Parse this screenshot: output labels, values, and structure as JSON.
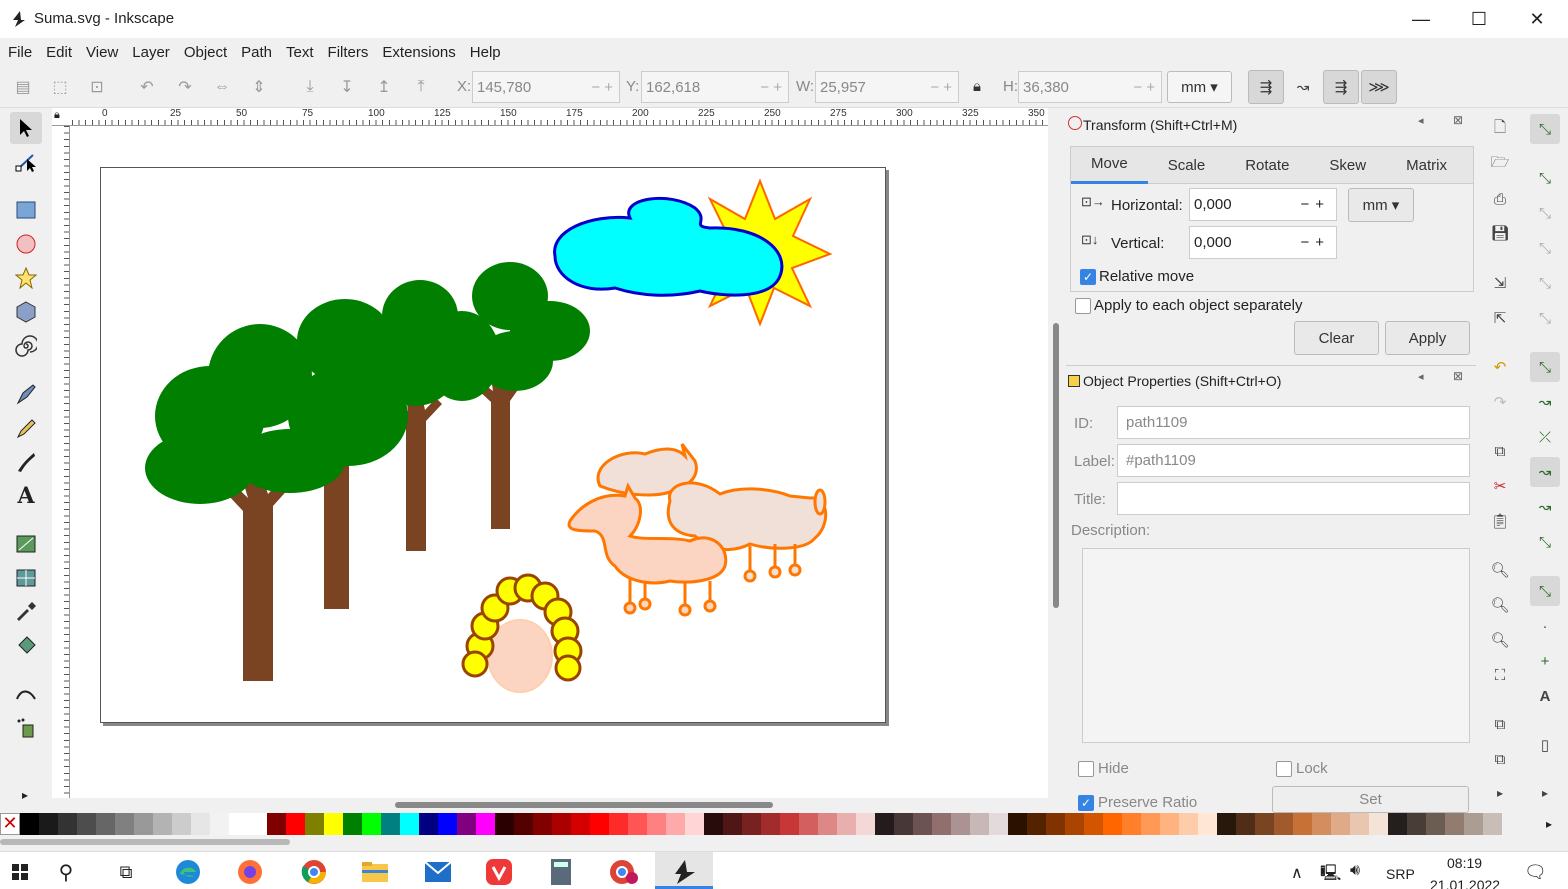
{
  "window": {
    "title": "Suma.svg - Inkscape",
    "minimize": "—",
    "maximize": "☐",
    "close": "✕"
  },
  "menu": [
    "File",
    "Edit",
    "View",
    "Layer",
    "Object",
    "Path",
    "Text",
    "Filters",
    "Extensions",
    "Help"
  ],
  "coords": {
    "x_label": "X:",
    "x": "145,780",
    "y_label": "Y:",
    "y": "162,618",
    "w_label": "W:",
    "w": "25,957",
    "h_label": "H:",
    "h": "36,380",
    "unit": "mm"
  },
  "ruler_h": [
    "0",
    "25",
    "50",
    "75",
    "100",
    "125",
    "150",
    "175",
    "200",
    "225",
    "250",
    "275",
    "300",
    "325",
    "350"
  ],
  "transform": {
    "title": "Transform (Shift+Ctrl+M)",
    "tabs": [
      "Move",
      "Scale",
      "Rotate",
      "Skew",
      "Matrix"
    ],
    "active_tab": "Move",
    "horizontal_label": "Horizontal:",
    "horizontal": "0,000",
    "vertical_label": "Vertical:",
    "vertical": "0,000",
    "unit": "mm",
    "relative_move": "Relative move",
    "relative_move_checked": true,
    "apply_each": "Apply to each object separately",
    "apply_each_checked": false,
    "clear": "Clear",
    "apply": "Apply"
  },
  "objprops": {
    "title": "Object Properties (Shift+Ctrl+O)",
    "id_label": "ID:",
    "id": "path1109",
    "label_label": "Label:",
    "label": "#path1109",
    "title_label": "Title:",
    "title_value": "",
    "description_label": "Description:",
    "hide": "Hide",
    "lock": "Lock",
    "preserve_ratio": "Preserve Ratio",
    "set": "Set"
  },
  "palette_colors": [
    "#000000",
    "#1a1a1a",
    "#333333",
    "#4d4d4d",
    "#666666",
    "#808080",
    "#999999",
    "#b3b3b3",
    "#cccccc",
    "#e6e6e6",
    "#f2f2f2",
    "#ffffff",
    "#ffffff",
    "#800000",
    "#ff0000",
    "#808000",
    "#ffff00",
    "#008000",
    "#00ff00",
    "#008080",
    "#00ffff",
    "#000080",
    "#0000ff",
    "#800080",
    "#ff00ff",
    "#2b0000",
    "#550000",
    "#800000",
    "#aa0000",
    "#d40000",
    "#ff0000",
    "#ff2a2a",
    "#ff5555",
    "#ff8080",
    "#ffaaaa",
    "#ffd5d5",
    "#280b0b",
    "#501616",
    "#782121",
    "#a02c2c",
    "#c83737",
    "#d35f5f",
    "#de8787",
    "#e9afaf",
    "#f4d7d7",
    "#241c1c",
    "#483737",
    "#6c5353",
    "#916f6f",
    "#ac9393",
    "#c8b7b7",
    "#e3dbdb",
    "#2b1100",
    "#552200",
    "#803300",
    "#aa4400",
    "#d45500",
    "#ff6600",
    "#ff7f2a",
    "#ff9955",
    "#ffb380",
    "#ffccaa",
    "#ffe6d5",
    "#28170b",
    "#502d16",
    "#784421",
    "#a05a2c",
    "#c87137",
    "#d38d5f",
    "#deaa87",
    "#e9c6af",
    "#f4e3d7",
    "#241f1c",
    "#483e37",
    "#6c5d53",
    "#917c6f",
    "#ac9d93",
    "#c8beb7"
  ],
  "taskbar": {
    "time": "08:19",
    "date": "21.01.2022",
    "lang": "SRP"
  },
  "status": {
    "zoom": ""
  }
}
